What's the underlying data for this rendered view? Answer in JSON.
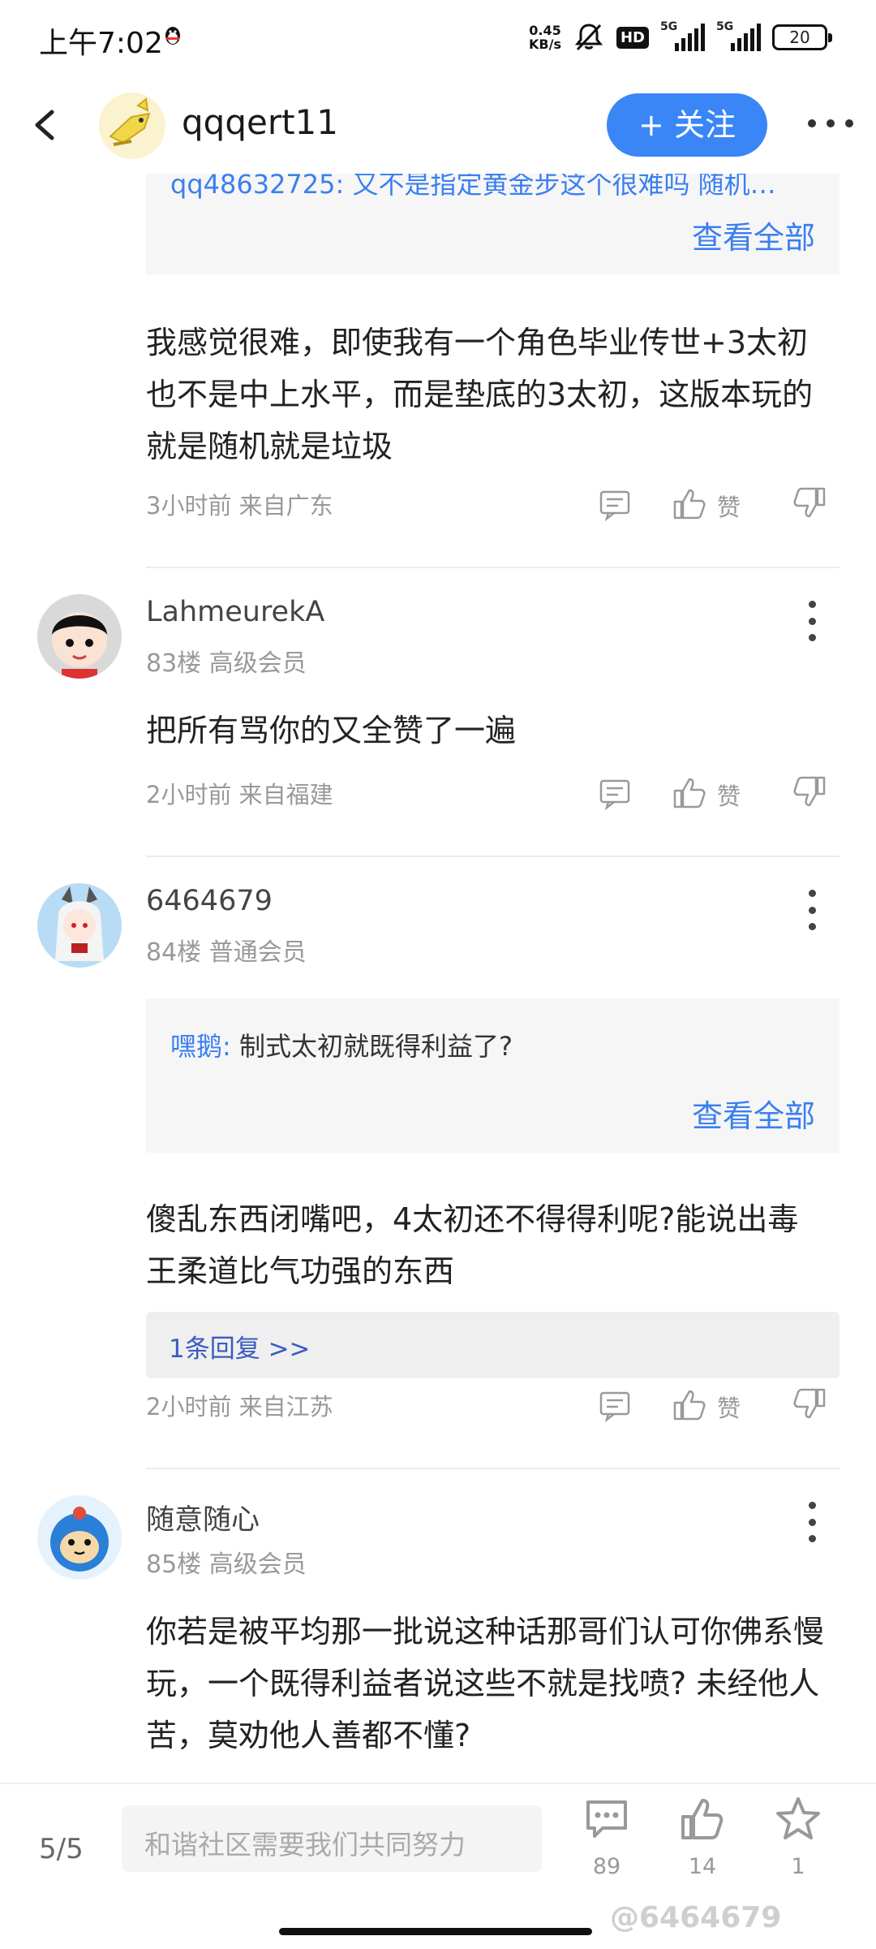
{
  "status_bar": {
    "time": "上午7:02",
    "net_speed_value": "0.45",
    "net_speed_unit": "KB/s",
    "hd_label": "HD",
    "sim1_label": "5G",
    "sim2_label": "5G",
    "battery": "20"
  },
  "header": {
    "username": "qqqert11",
    "follow_label": "+ 关注"
  },
  "comments": [
    {
      "quote_text": "qq48632725: 又不是指定黄金步这个很难吗 随机…",
      "view_all": "查看全部",
      "body": "我感觉很难，即使我有一个角色毕业传世+3太初也不是中上水平，而是垫底的3太初，这版本玩的就是随机就是垃圾",
      "meta": "3小时前 来自广东",
      "like_label": "赞"
    },
    {
      "username": "LahmeurekA",
      "floor": "83楼 高级会员",
      "body": "把所有骂你的又全赞了一遍",
      "meta": "2小时前 来自福建",
      "like_label": "赞"
    },
    {
      "username": "6464679",
      "floor": "84楼 普通会员",
      "quote_author": "嘿鹅:",
      "quote_text": "制式太初就既得利益了?",
      "view_all": "查看全部",
      "body": "傻乱东西闭嘴吧，4太初还不得得利呢?能说出毒王柔道比气功强的东西",
      "reply_bar": "1条回复 >>",
      "meta": "2小时前 来自江苏",
      "like_label": "赞"
    },
    {
      "username": "随意随心",
      "floor": "85楼 高级会员",
      "body": "你若是被平均那一批说这种话那哥们认可你佛系慢玩，一个既得利益者说这些不就是找喷? 未经他人苦，莫劝他人善都不懂?"
    }
  ],
  "bottom_bar": {
    "page": "5/5",
    "input_placeholder": "和谐社区需要我们共同努力",
    "comment_count": "89",
    "like_count": "14",
    "star_count": "1",
    "watermark": "@6464679"
  }
}
